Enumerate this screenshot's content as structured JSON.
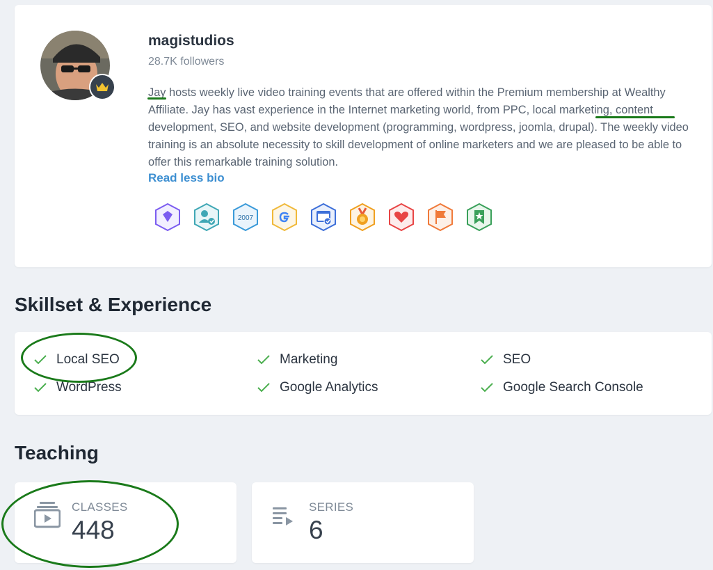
{
  "profile": {
    "username": "magistudios",
    "followers": "28.7K followers",
    "bio": "Jay hosts weekly live video training events that are offered within the Premium membership at Wealthy Affiliate. Jay has vast experience in the Internet marketing world, from PPC, local marketing, content development, SEO, and website development (programming, wordpress, joomla, drupal). The weekly video training is an absolute necessity to skill development of online marketers and we are pleased to be able to offer this remarkable training solution.",
    "read_less": "Read less bio",
    "badges": [
      {
        "icon": "diamond-badge-icon",
        "color": "#7b5cf0"
      },
      {
        "icon": "verified-user-badge-icon",
        "color": "#3fa7b5"
      },
      {
        "icon": "year-2007-badge-icon",
        "color": "#3a9ad9",
        "text": "2007"
      },
      {
        "icon": "google-badge-icon",
        "color": "#f0b93a"
      },
      {
        "icon": "website-badge-icon",
        "color": "#3d6fd9"
      },
      {
        "icon": "medal-badge-icon",
        "color": "#f0a020"
      },
      {
        "icon": "heart-badge-icon",
        "color": "#e84545"
      },
      {
        "icon": "flag-badge-icon",
        "color": "#f07a3a"
      },
      {
        "icon": "star-bookmark-badge-icon",
        "color": "#3aa05a"
      }
    ]
  },
  "skills": {
    "title": "Skillset & Experience",
    "items": [
      "Local SEO",
      "Marketing",
      "SEO",
      "WordPress",
      "Google Analytics",
      "Google Search Console"
    ]
  },
  "teaching": {
    "title": "Teaching",
    "classes": {
      "label": "CLASSES",
      "value": "448"
    },
    "series": {
      "label": "SERIES",
      "value": "6"
    }
  },
  "colors": {
    "accent_link": "#3d8fd1",
    "check_green": "#4caf50",
    "annotation_green": "#1a7a1a"
  }
}
